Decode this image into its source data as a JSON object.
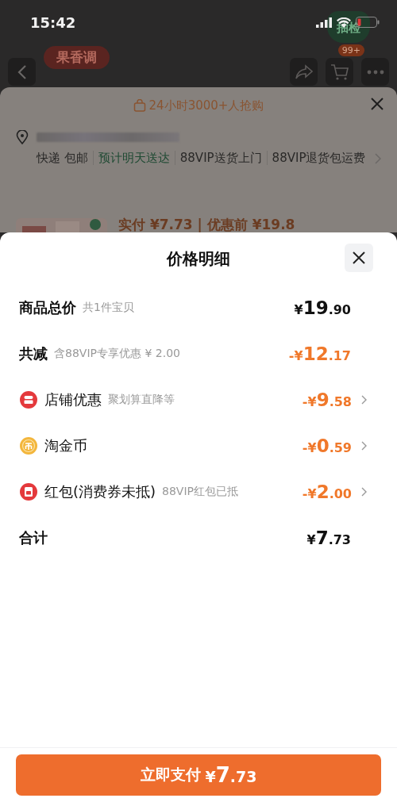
{
  "status_bar": {
    "time": "15:42"
  },
  "backdrop": {
    "nav": {
      "tag": "果香调",
      "cart_badge": "99+",
      "inspect_badge": "抽检"
    },
    "card": {
      "headline": "24小时3000+人抢购",
      "delivery": [
        {
          "text": "快递 包邮",
          "highlight": false
        },
        {
          "text": "预计明天送达",
          "highlight": true
        },
        {
          "text": "88VIP送货上门",
          "highlight": false
        },
        {
          "text": "88VIP退货包运费",
          "highlight": false
        }
      ],
      "price_line": "实付 ¥7.73 | 优惠前 ¥19.8"
    }
  },
  "sheet": {
    "title": "价格明细",
    "rows": [
      {
        "kind": "total",
        "label": "商品总价",
        "note": "共1件宝贝",
        "amount": "¥19.90"
      },
      {
        "kind": "reduction",
        "label": "共减",
        "note": "含88VIP专享优惠 ¥ 2.00",
        "amount": "-¥12.17"
      },
      {
        "kind": "discount",
        "label": "店铺优惠",
        "note": "聚划算直降等",
        "amount": "-¥9.58"
      },
      {
        "kind": "discount",
        "label": "淘金币",
        "amount": "-¥0.59"
      },
      {
        "kind": "discount",
        "label": "红包(消费券未抵)",
        "note": "88VIP红包已抵",
        "amount": "-¥2.00"
      },
      {
        "kind": "total",
        "label": "合计",
        "amount": "¥7.73"
      }
    ]
  },
  "pay_button": {
    "label": "立即支付",
    "amount": "¥7.73"
  }
}
